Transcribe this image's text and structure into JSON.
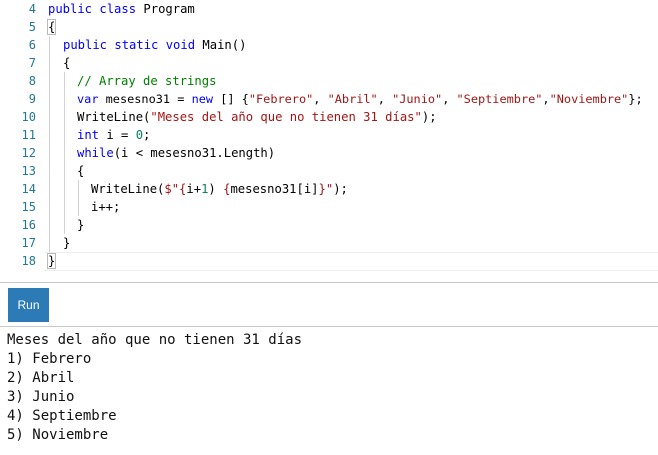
{
  "editor": {
    "line_numbers": [
      "4",
      "5",
      "6",
      "7",
      "8",
      "9",
      "10",
      "11",
      "12",
      "13",
      "14",
      "15",
      "16",
      "17",
      "18"
    ],
    "line4": {
      "kw": "public class",
      "rest": " Program"
    },
    "line5": {
      "brace": "{"
    },
    "line6": {
      "kw": "public static void",
      "rest": " Main()"
    },
    "line7": {
      "text": "{"
    },
    "line8": {
      "comment": "// Array de strings"
    },
    "line9": {
      "kw1": "var",
      "mid1": " mesesno31 = ",
      "kw2": "new",
      "mid2": " [] {",
      "s1": "\"Febrero\"",
      "c1": ", ",
      "s2": "\"Abril\"",
      "c2": ", ",
      "s3": "\"Junio\"",
      "c3": ", ",
      "s4": "\"Septiembre\"",
      "c4": ",",
      "s5": "\"Noviembre\"",
      "end": "};"
    },
    "line10": {
      "pre": "WriteLine(",
      "str": "\"Meses del año que no tienen 31 días\"",
      "post": ");"
    },
    "line11": {
      "kw": "int",
      "mid": " i = ",
      "num": "0",
      "end": ";"
    },
    "line12": {
      "kw": "while",
      "rest": "(i < mesesno31.Length)"
    },
    "line13": {
      "text": "{"
    },
    "line14": {
      "pre": "WriteLine(",
      "s1": "$\"{",
      "e1": "i+",
      "n1": "1",
      "e2": ")",
      "s2": " {",
      "e3": "mesesno31[i]",
      "s3": "}\"",
      "post": ");"
    },
    "line15": {
      "text": "i++;"
    },
    "line16": {
      "text": "}"
    },
    "line17": {
      "text": "}"
    },
    "line18": {
      "brace": "}"
    }
  },
  "toolbar": {
    "run_label": "Run"
  },
  "output": {
    "lines": [
      "Meses del año que no tienen 31 días",
      "1) Febrero",
      "2) Abril",
      "3) Junio",
      "4) Septiembre",
      "5) Noviembre"
    ]
  },
  "colors": {
    "keyword": "#0000ff",
    "string": "#a31515",
    "comment": "#008000",
    "number": "#098658",
    "line_number": "#237893",
    "run_button": "#2c7bb6"
  }
}
